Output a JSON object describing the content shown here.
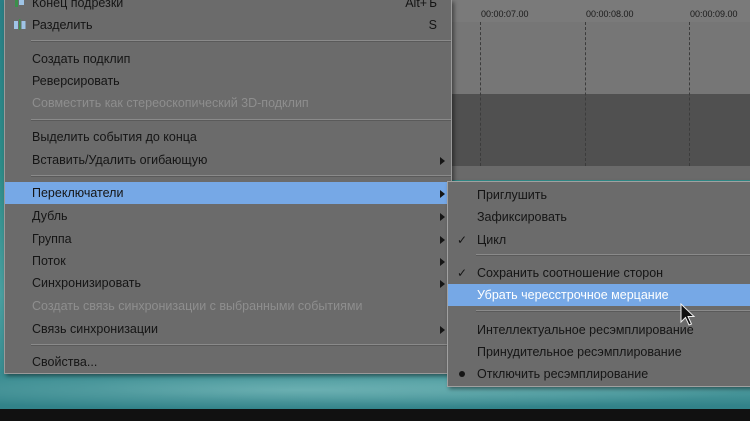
{
  "timeline": {
    "ruler": [
      "00:00:07.00",
      "00:00:08.00",
      "00:00:09.00"
    ]
  },
  "menu": {
    "items": [
      {
        "label": "Конец подрезки",
        "shortcut": "Alt+Ъ",
        "icon": "trim-end-icon"
      },
      {
        "label": "Разделить",
        "shortcut": "S",
        "icon": "split-icon"
      },
      {
        "label": "Создать подклип"
      },
      {
        "label": "Реверсировать"
      },
      {
        "label": "Совместить как стереоскопический 3D-подклип",
        "disabled": true
      },
      {
        "label": "Выделить события до конца"
      },
      {
        "label": "Вставить/Удалить огибающую",
        "submenu": true
      },
      {
        "label": "Переключатели",
        "submenu": true,
        "highlighted": true
      },
      {
        "label": "Дубль",
        "submenu": true
      },
      {
        "label": "Группа",
        "submenu": true
      },
      {
        "label": "Поток",
        "submenu": true
      },
      {
        "label": "Синхронизировать",
        "submenu": true
      },
      {
        "label": "Создать связь синхронизации с выбранными событиями",
        "disabled": true
      },
      {
        "label": "Связь синхронизации",
        "submenu": true
      },
      {
        "label": "Свойства..."
      }
    ]
  },
  "submenu": {
    "items": [
      {
        "label": "Приглушить"
      },
      {
        "label": "Зафиксировать"
      },
      {
        "label": "Цикл",
        "mark": "check"
      },
      {
        "label": "Сохранить соотношение сторон",
        "mark": "check"
      },
      {
        "label": "Убрать чересстрочное мерцание",
        "highlighted": true
      },
      {
        "label": "Интеллектуальное ресэмплирование"
      },
      {
        "label": "Принудительное ресэмплирование"
      },
      {
        "label": "Отключить ресэмплирование",
        "mark": "dot"
      }
    ],
    "check_glyph": "✓"
  },
  "colors": {
    "menu_bg": "#6b6b6b",
    "highlight": "#76a8e6",
    "desktop": "#2e8b88"
  }
}
